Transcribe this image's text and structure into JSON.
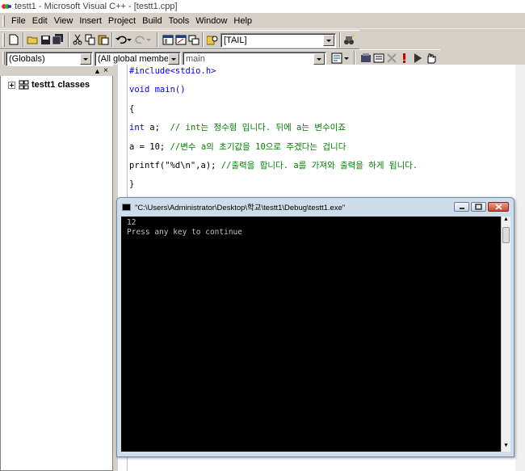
{
  "window": {
    "title": "testt1 - Microsoft Visual C++ - [testt1.cpp]"
  },
  "menu": {
    "items": [
      "File",
      "Edit",
      "View",
      "Insert",
      "Project",
      "Build",
      "Tools",
      "Window",
      "Help"
    ]
  },
  "toolbar": {
    "find_combo_value": "[TAIL]"
  },
  "wizardbar": {
    "class_combo": "(Globals)",
    "members_combo": "(All global members",
    "function_combo": "main"
  },
  "workspace": {
    "tree_root": "testt1 classes"
  },
  "editor": {
    "lines": [
      {
        "text": "#include<stdio.h>"
      },
      {
        "text": "void main()"
      },
      {
        "text": "{"
      },
      {
        "kw": "int",
        "code": " a;  ",
        "comment": "// int는 정수형 입니다. 뒤에 a는 변수이죠"
      },
      {
        "code": "a = 10; ",
        "comment": "//변수 a의 초기값을 10으로 주겠다는 겁니다"
      },
      {
        "code": "printf(\"%d\\n\",a); ",
        "comment": "//출력을 합니다. a를 가져와 출력을 하게 됩니다."
      },
      {
        "text": "}"
      }
    ]
  },
  "console": {
    "title": "\"C:\\Users\\Administrator\\Desktop\\학교\\testt1\\Debug\\testt1.exe\"",
    "output": [
      "12",
      "Press any key to continue"
    ]
  },
  "colors": {
    "keyword": "#0000ff",
    "comment": "#008000",
    "console_bg": "#000000",
    "chrome": "#d4d0c8"
  }
}
